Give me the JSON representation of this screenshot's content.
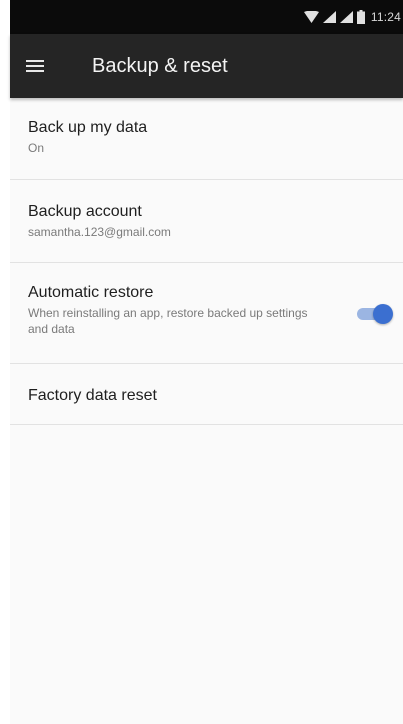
{
  "status_bar": {
    "time": "11:24",
    "icons": [
      "wifi-icon",
      "signal-icon",
      "signal-icon",
      "battery-icon"
    ]
  },
  "toolbar": {
    "menu_icon": "hamburger-menu-icon",
    "title": "Backup & reset"
  },
  "preferences": [
    {
      "title": "Back up my data",
      "summary": "On"
    },
    {
      "title": "Backup account",
      "summary": "samantha.123@gmail.com"
    },
    {
      "title": "Automatic restore",
      "summary": "When reinstalling an app, restore backed up settings and data",
      "toggle": true
    },
    {
      "title": "Factory data reset",
      "summary": ""
    }
  ],
  "colors": {
    "status_bar": "#0b0b0b",
    "toolbar": "#252525",
    "accent": "#3b6fd0",
    "background": "#fafafa"
  }
}
